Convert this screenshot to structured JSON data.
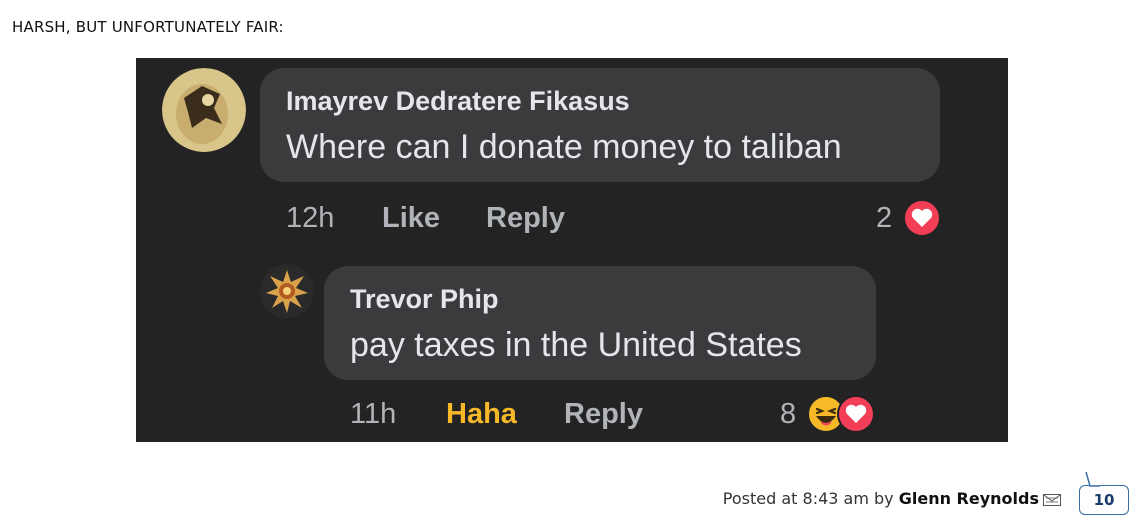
{
  "post": {
    "title": "HARSH, BUT UNFORTUNATELY FAIR:"
  },
  "screenshot": {
    "comments": [
      {
        "author": "Imayrev Dedratere Fikasus",
        "text": "Where can I donate money to taliban",
        "time": "12h",
        "action_react": "Like",
        "action_reply": "Reply",
        "reaction_count": "2",
        "reaction_icons": [
          "love-icon"
        ]
      },
      {
        "author": "Trevor Phip",
        "text": "pay taxes in the United States",
        "time": "11h",
        "action_react": "Haha",
        "action_reply": "Reply",
        "reaction_count": "8",
        "reaction_icons": [
          "haha-icon",
          "love-icon"
        ]
      }
    ],
    "colors": {
      "background": "#232324",
      "bubble": "#3a3b3c",
      "haha": "#f7b928",
      "love": "#f33e58"
    }
  },
  "footer": {
    "posted_prefix": "Posted at 8:43 am by",
    "author": "Glenn Reynolds",
    "comment_count": "10"
  }
}
